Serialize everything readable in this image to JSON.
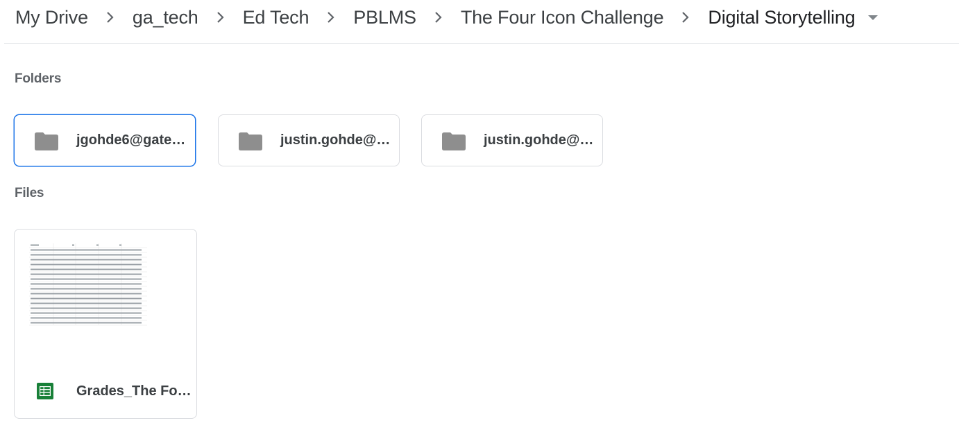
{
  "breadcrumb": {
    "items": [
      "My Drive",
      "ga_tech",
      "Ed Tech",
      "PBLMS",
      "The Four Icon Challenge",
      "Digital Storytelling"
    ]
  },
  "sections": {
    "folders_label": "Folders",
    "files_label": "Files"
  },
  "folders": [
    {
      "name": "jgohde6@gate…",
      "selected": true
    },
    {
      "name": "justin.gohde@…",
      "selected": false
    },
    {
      "name": "justin.gohde@…",
      "selected": false
    }
  ],
  "files": [
    {
      "name": "Grades_The Fo…",
      "type": "google-sheets",
      "icon_color": "#188038"
    }
  ],
  "colors": {
    "folder_icon": "#8e8e8e",
    "selected_border": "#1a73e8",
    "sheets_green": "#188038"
  }
}
